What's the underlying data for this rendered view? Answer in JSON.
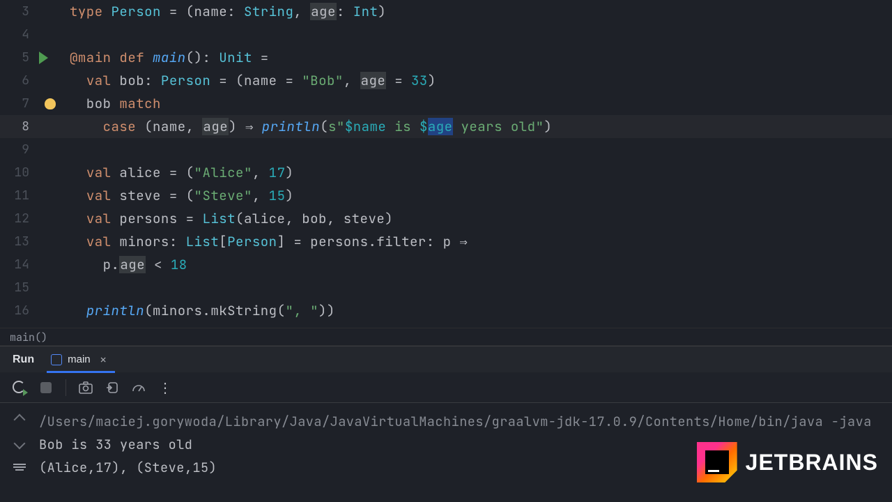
{
  "editor": {
    "lines": [
      {
        "n": 3,
        "gap": "",
        "html": "<span class='kw'>type</span> <span class='type'>Person</span> <span class='op'>=</span> (name: <span class='type'>String</span>, <span class='hl'>age</span>: <span class='type'>Int</span>)"
      },
      {
        "n": 4,
        "gap": "",
        "html": ""
      },
      {
        "n": 5,
        "gap": "run",
        "html": "<span class='kw'>@main</span> <span class='kw'>def</span> <span class='fn'>main</span>(): <span class='type'>Unit</span> <span class='op'>=</span>"
      },
      {
        "n": 6,
        "gap": "",
        "html": "  <span class='kw'>val</span> bob: <span class='type'>Person</span> <span class='op'>=</span> (name <span class='op'>=</span> <span class='str'>\"Bob\"</span>, <span class='hl'>age</span> <span class='op'>=</span> <span class='num'>33</span>)"
      },
      {
        "n": 7,
        "gap": "bulb",
        "html": "  bob <span class='kw'>match</span>"
      },
      {
        "n": 8,
        "gap": "",
        "current": true,
        "html": "    <span class='kw'>case</span> (name, <span class='hl'>age</span>) <span class='op'>⇒</span> <span class='fn'>println</span>(<span class='str'>s\"</span><span class='tplvar'>$name</span><span class='str'> is </span><span class='tplvar'>$</span><span class='tplvar sel'>age</span><span class='str'> years old\"</span>)"
      },
      {
        "n": 9,
        "gap": "",
        "html": ""
      },
      {
        "n": 10,
        "gap": "",
        "html": "  <span class='kw'>val</span> alice <span class='op'>=</span> (<span class='str'>\"Alice\"</span>, <span class='num'>17</span>)"
      },
      {
        "n": 11,
        "gap": "",
        "html": "  <span class='kw'>val</span> steve <span class='op'>=</span> (<span class='str'>\"Steve\"</span>, <span class='num'>15</span>)"
      },
      {
        "n": 12,
        "gap": "",
        "html": "  <span class='kw'>val</span> persons <span class='op'>=</span> <span class='type'>List</span>(alice, bob, steve)"
      },
      {
        "n": 13,
        "gap": "",
        "html": "  <span class='kw'>val</span> minors: <span class='type'>List</span>[<span class='type'>Person</span>] <span class='op'>=</span> persons.filter: p <span class='op'>⇒</span>"
      },
      {
        "n": 14,
        "gap": "",
        "html": "    p.<span class='hl'>age</span> <span class='op'>&lt;</span> <span class='num'>18</span>"
      },
      {
        "n": 15,
        "gap": "",
        "html": ""
      },
      {
        "n": 16,
        "gap": "",
        "html": "  <span class='fn'>println</span>(minors.mkString(<span class='str'>\", \"</span>))"
      }
    ]
  },
  "breadcrumb": "main()",
  "toolwindow": {
    "title": "Run",
    "tab_label": "main"
  },
  "console": {
    "command": "/Users/maciej.gorywoda/Library/Java/JavaVirtualMachines/graalvm-jdk-17.0.9/Contents/Home/bin/java -java",
    "out1": "Bob is 33 years old",
    "out2": "(Alice,17), (Steve,15)"
  },
  "logo_text": "JETBRAINS"
}
